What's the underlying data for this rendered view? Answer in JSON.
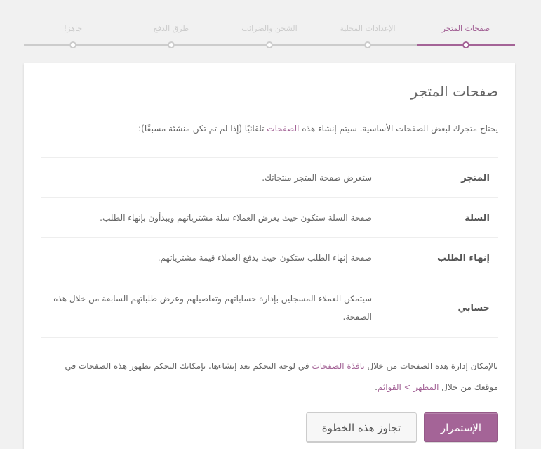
{
  "steps": [
    {
      "label": "صفحات المتجر",
      "active": true
    },
    {
      "label": "الإعدادات المحلية",
      "active": false
    },
    {
      "label": "الشحن والضرائب",
      "active": false
    },
    {
      "label": "طرق الدفع",
      "active": false
    },
    {
      "label": "جاهز!",
      "active": false
    }
  ],
  "card": {
    "title": "صفحات المتجر",
    "intro_before": "يحتاج متجرك لبعض الصفحات الأساسية. سيتم إنشاء هذه ",
    "intro_link": "الصفحات",
    "intro_after": " تلقائيًا (إذا لم تم تكن منشئة مسبقًا):",
    "rows": [
      {
        "name": "المتجر",
        "desc": "ستعرض صفحة المتجر منتجاتك."
      },
      {
        "name": "السلة",
        "desc": "صفحة السلة ستكون حيث يعرض العملاء سلة مشترياتهم ويبدأون بإنهاء الطلب."
      },
      {
        "name": "إنهاء الطلب",
        "desc": "صفحة إنهاء الطلب ستكون حيث يدفع العملاء قيمة مشترياتهم."
      },
      {
        "name": "حسابي",
        "desc": "سيتمكن العملاء المسجلين بإدارة حساباتهم وتفاصيلهم وعرض طلباتهم السابقة من خلال هذه الصفحة."
      }
    ],
    "footer_part1": "بالإمكان إدارة هذه الصفحات من خلال ",
    "footer_link1": "نافذة الصفحات",
    "footer_part2": " في لوحة التحكم بعد إنشاءها. بإمكانك التحكم بظهور  هذه الصفحات في موقعك من خلال ",
    "footer_link2": "المظهر > القوائم",
    "footer_part3": "."
  },
  "buttons": {
    "continue": "الإستمرار",
    "skip": "تجاوز هذه الخطوة"
  },
  "colors": {
    "accent": "#a46497",
    "inactive": "#cccccc"
  }
}
